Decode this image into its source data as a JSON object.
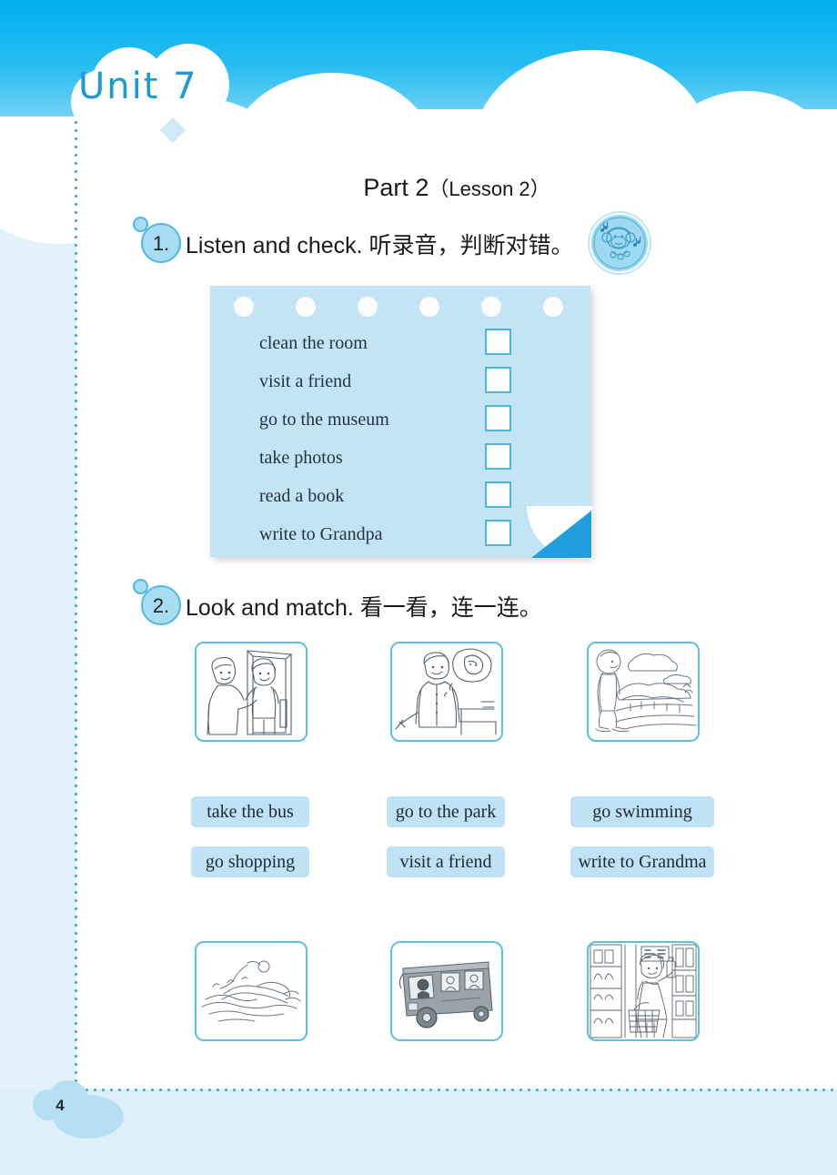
{
  "header": {
    "unit_label": "Unit 7",
    "page_number": "4"
  },
  "part_title": {
    "main": "Part 2",
    "lesson": "（Lesson 2）"
  },
  "exercises": [
    {
      "number": "1.",
      "instruction_en": "Listen and check.",
      "instruction_cn": "听录音，判断对错。",
      "audio_icon": "monkey-headphones-icon"
    },
    {
      "number": "2.",
      "instruction_en": "Look and match.",
      "instruction_cn": "看一看，连一连。"
    }
  ],
  "notepad": {
    "items": [
      "clean the room",
      "visit a friend",
      "go to the museum",
      "take photos",
      "read a book",
      "write to Grandpa"
    ],
    "hole_count": 6,
    "checkbox_state": [
      "",
      "",
      "",
      "",
      "",
      ""
    ]
  },
  "match": {
    "top_pictures": [
      {
        "name": "visit-a-friend-picture",
        "alt": "boy greeting friend at the door"
      },
      {
        "name": "write-to-grandma-picture",
        "alt": "boy writing a letter thinking of grandma"
      },
      {
        "name": "go-to-the-park-picture",
        "alt": "boy walking in a park"
      }
    ],
    "chips_row1": [
      "take the bus",
      "go to the park",
      "go swimming"
    ],
    "chips_row2": [
      "go shopping",
      "visit a friend",
      "write to Grandma"
    ],
    "bottom_pictures": [
      {
        "name": "go-swimming-picture",
        "alt": "person swimming in water"
      },
      {
        "name": "take-the-bus-picture",
        "alt": "bus with passengers"
      },
      {
        "name": "go-shopping-picture",
        "alt": "girl shopping in a store"
      }
    ]
  },
  "colors": {
    "sky_top": "#00adee",
    "sky_bottom": "#bfe8fb",
    "card_blue": "#c3e4f5",
    "accent_blue": "#1f9fdd",
    "border_blue": "#5cc0e0",
    "dot_blue": "#2fa8d8",
    "chip_blue": "#bfe2f5",
    "page_band": "#ddf0fa"
  }
}
